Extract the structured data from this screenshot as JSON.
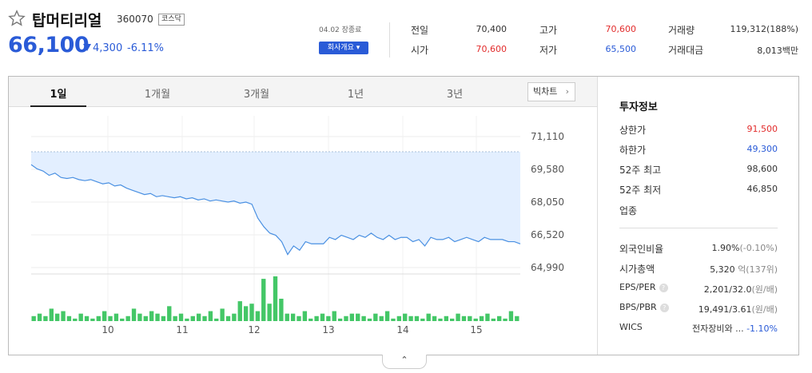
{
  "stock": {
    "name": "탑머티리얼",
    "code": "360070",
    "market": "코스닥",
    "price": "66,100",
    "change": "4,300",
    "change_pct": "-6.11%",
    "date": "04.02 장종료",
    "company_button": "회사개요 ▾"
  },
  "quotes": {
    "prev_label": "전일",
    "prev": "70,400",
    "high_label": "고가",
    "high": "70,600",
    "volume_label": "거래량",
    "volume": "119,312(188%)",
    "open_label": "시가",
    "open": "70,600",
    "low_label": "저가",
    "low": "65,500",
    "amount_label": "거래대금",
    "amount": "8,013백만"
  },
  "tabs": [
    "1일",
    "1개월",
    "3개월",
    "1년",
    "3년"
  ],
  "big_chart_button": "빅차트",
  "side": {
    "title": "투자정보",
    "upper_label": "상한가",
    "upper": "91,500",
    "lower_label": "하한가",
    "lower": "49,300",
    "w52high_label": "52주 최고",
    "w52high": "98,600",
    "w52low_label": "52주 최저",
    "w52low": "46,850",
    "sector_label": "업종",
    "foreign_label": "외국인비율",
    "foreign": "1.90%",
    "foreign_chg": "(-0.10%)",
    "mcap_label": "시가총액",
    "mcap": "5,320",
    "mcap_unit": "억(137위)",
    "eps_label": "EPS/PER",
    "eps": "2,201/32.0",
    "eps_unit": "(원/배)",
    "bps_label": "BPS/PBR",
    "bps": "19,491/3.61",
    "bps_unit": "(원/배)",
    "wics_label": "WICS",
    "wics": "전자장비와 ...",
    "wics_chg": "-1.10%"
  },
  "colors": {
    "up": "#e22c2c",
    "down": "#2a5bd7",
    "volume": "#44c767",
    "area": "#e3efff"
  },
  "chart_data": {
    "type": "area",
    "y_ticks": [
      "71,110",
      "69,580",
      "68,050",
      "66,520",
      "64,990"
    ],
    "x_ticks": [
      "10",
      "11",
      "12",
      "13",
      "14",
      "15"
    ],
    "ylim": [
      64990,
      71110
    ],
    "prev_close": 70400,
    "price": [
      69800,
      69600,
      69500,
      69300,
      69400,
      69200,
      69150,
      69200,
      69100,
      69050,
      69100,
      69000,
      68900,
      68950,
      68800,
      68850,
      68700,
      68600,
      68500,
      68400,
      68450,
      68300,
      68350,
      68300,
      68250,
      68300,
      68200,
      68250,
      68150,
      68200,
      68100,
      68150,
      68100,
      68050,
      68100,
      68000,
      68050,
      67950,
      67300,
      66900,
      66600,
      66500,
      66200,
      65600,
      66000,
      65800,
      66200,
      66100,
      66100,
      66100,
      66400,
      66300,
      66500,
      66400,
      66300,
      66500,
      66400,
      66600,
      66400,
      66300,
      66500,
      66300,
      66400,
      66400,
      66200,
      66300,
      66000,
      66400,
      66300,
      66300,
      66400,
      66200,
      66300,
      66400,
      66300,
      66200,
      66400,
      66300,
      66300,
      66300,
      66200,
      66200,
      66100
    ],
    "volume": [
      2,
      3,
      2,
      5,
      3,
      4,
      2,
      1,
      3,
      2,
      1,
      2,
      4,
      2,
      3,
      1,
      2,
      5,
      3,
      2,
      4,
      3,
      2,
      6,
      2,
      3,
      1,
      2,
      3,
      2,
      4,
      1,
      5,
      2,
      3,
      8,
      6,
      7,
      4,
      17,
      7,
      18,
      9,
      3,
      3,
      2,
      4,
      1,
      2,
      3,
      2,
      4,
      1,
      2,
      3,
      3,
      2,
      1,
      3,
      2,
      4,
      1,
      2,
      3,
      2,
      2,
      1,
      3,
      2,
      1,
      2,
      1,
      3,
      2,
      2,
      1,
      2,
      3,
      1,
      2,
      1,
      4,
      2
    ]
  }
}
